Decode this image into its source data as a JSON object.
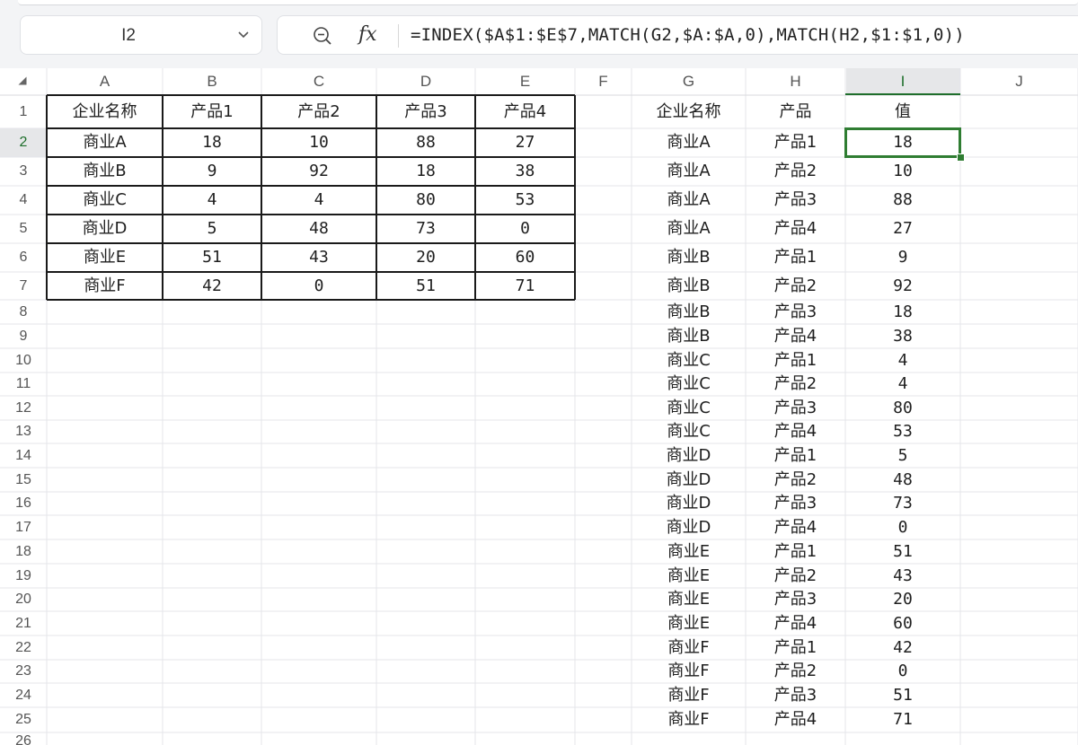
{
  "name_box": {
    "value": "I2"
  },
  "formula_bar": {
    "zoom_icon": "zoom-out-icon",
    "fx_label": "fx",
    "formula": "=INDEX($A$1:$E$7,MATCH(G2,$A:$A,0),MATCH(H2,$1:$1,0))"
  },
  "sheet": {
    "columns": [
      "A",
      "B",
      "C",
      "D",
      "E",
      "F",
      "G",
      "H",
      "I",
      "J"
    ],
    "rows": [
      "1",
      "2",
      "3",
      "4",
      "5",
      "6",
      "7",
      "8",
      "9",
      "10",
      "11",
      "12",
      "13",
      "14",
      "15",
      "16",
      "17",
      "18",
      "19",
      "20",
      "21",
      "22",
      "23",
      "24",
      "25",
      "26"
    ],
    "active_cell": "I2",
    "active_column": "I",
    "active_row": "2",
    "source_table": {
      "headers": [
        "企业名称",
        "产品1",
        "产品2",
        "产品3",
        "产品4"
      ],
      "rows": [
        [
          "商业A",
          "18",
          "10",
          "88",
          "27"
        ],
        [
          "商业B",
          "9",
          "92",
          "18",
          "38"
        ],
        [
          "商业C",
          "4",
          "4",
          "80",
          "53"
        ],
        [
          "商业D",
          "5",
          "48",
          "73",
          "0"
        ],
        [
          "商业E",
          "51",
          "43",
          "20",
          "60"
        ],
        [
          "商业F",
          "42",
          "0",
          "51",
          "71"
        ]
      ]
    },
    "result_table": {
      "headers": [
        "企业名称",
        "产品",
        "值"
      ],
      "rows": [
        [
          "商业A",
          "产品1",
          "18"
        ],
        [
          "商业A",
          "产品2",
          "10"
        ],
        [
          "商业A",
          "产品3",
          "88"
        ],
        [
          "商业A",
          "产品4",
          "27"
        ],
        [
          "商业B",
          "产品1",
          "9"
        ],
        [
          "商业B",
          "产品2",
          "92"
        ],
        [
          "商业B",
          "产品3",
          "18"
        ],
        [
          "商业B",
          "产品4",
          "38"
        ],
        [
          "商业C",
          "产品1",
          "4"
        ],
        [
          "商业C",
          "产品2",
          "4"
        ],
        [
          "商业C",
          "产品3",
          "80"
        ],
        [
          "商业C",
          "产品4",
          "53"
        ],
        [
          "商业D",
          "产品1",
          "5"
        ],
        [
          "商业D",
          "产品2",
          "48"
        ],
        [
          "商业D",
          "产品3",
          "73"
        ],
        [
          "商业D",
          "产品4",
          "0"
        ],
        [
          "商业E",
          "产品1",
          "51"
        ],
        [
          "商业E",
          "产品2",
          "43"
        ],
        [
          "商业E",
          "产品3",
          "20"
        ],
        [
          "商业E",
          "产品4",
          "60"
        ],
        [
          "商业F",
          "产品1",
          "42"
        ],
        [
          "商业F",
          "产品2",
          "0"
        ],
        [
          "商业F",
          "产品3",
          "51"
        ],
        [
          "商业F",
          "产品4",
          "71"
        ]
      ]
    }
  },
  "colors": {
    "selection": "#2f7d32",
    "active_header": "#1e6e2b",
    "gridline": "#e4e6ea"
  }
}
